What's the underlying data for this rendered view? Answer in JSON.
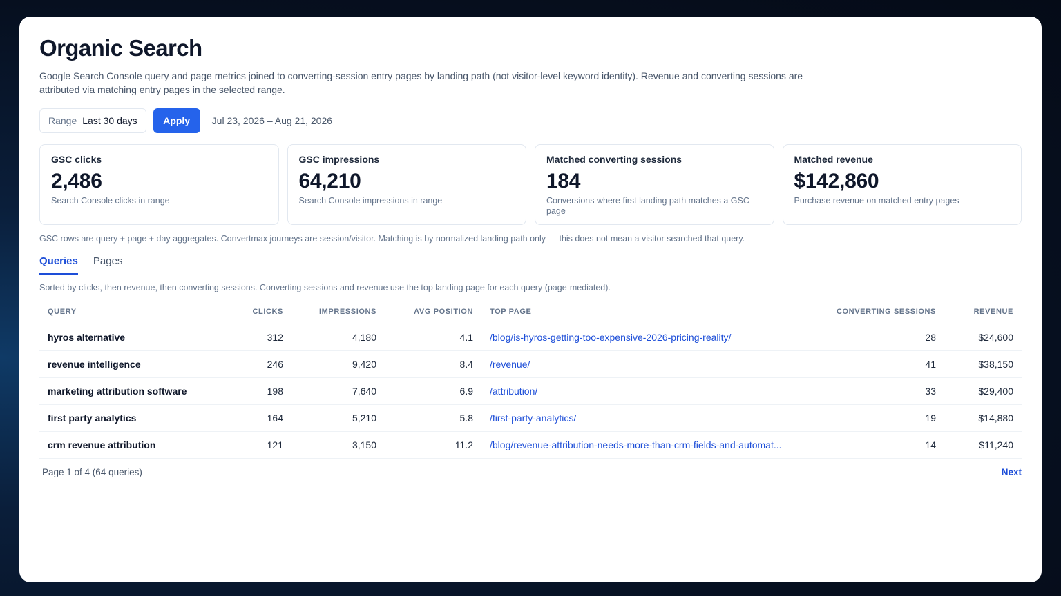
{
  "header": {
    "title": "Organic Search",
    "description": "Google Search Console query and page metrics joined to converting-session entry pages by landing path (not visitor-level keyword identity). Revenue and converting sessions are attributed via matching entry pages in the selected range."
  },
  "controls": {
    "range_label": "Range",
    "range_value": "Last 30 days",
    "apply_label": "Apply",
    "date_range": "Jul 23, 2026 – Aug 21, 2026"
  },
  "kpis": [
    {
      "label": "GSC clicks",
      "value": "2,486",
      "note": "Search Console clicks in range"
    },
    {
      "label": "GSC impressions",
      "value": "64,210",
      "note": "Search Console impressions in range"
    },
    {
      "label": "Matched converting sessions",
      "value": "184",
      "note": "Conversions where first landing path matches a GSC page"
    },
    {
      "label": "Matched revenue",
      "value": "$142,860",
      "note": "Purchase revenue on matched entry pages"
    }
  ],
  "footnote": "GSC rows are query + page + day aggregates. Convertmax journeys are session/visitor. Matching is by normalized landing path only — this does not mean a visitor searched that query.",
  "tabs": [
    {
      "label": "Queries",
      "active": true
    },
    {
      "label": "Pages",
      "active": false
    }
  ],
  "sort_note": "Sorted by clicks, then revenue, then converting sessions. Converting sessions and revenue use the top landing page for each query (page-mediated).",
  "table": {
    "columns": [
      "Query",
      "Clicks",
      "Impressions",
      "Avg position",
      "Top page",
      "Converting sessions",
      "Revenue"
    ],
    "rows": [
      [
        "hyros alternative",
        "312",
        "4,180",
        "4.1",
        "/blog/is-hyros-getting-too-expensive-2026-pricing-reality/",
        "28",
        "$24,600"
      ],
      [
        "revenue intelligence",
        "246",
        "9,420",
        "8.4",
        "/revenue/",
        "41",
        "$38,150"
      ],
      [
        "marketing attribution software",
        "198",
        "7,640",
        "6.9",
        "/attribution/",
        "33",
        "$29,400"
      ],
      [
        "first party analytics",
        "164",
        "5,210",
        "5.8",
        "/first-party-analytics/",
        "19",
        "$14,880"
      ],
      [
        "crm revenue attribution",
        "121",
        "3,150",
        "11.2",
        "/blog/revenue-attribution-needs-more-than-crm-fields-and-automat...",
        "14",
        "$11,240"
      ]
    ]
  },
  "pager": {
    "info": "Page 1 of 4 (64 queries)",
    "next_label": "Next"
  }
}
